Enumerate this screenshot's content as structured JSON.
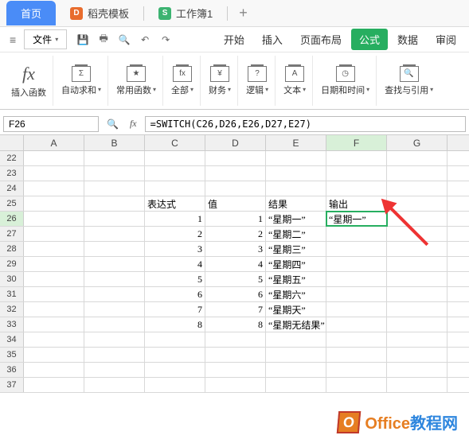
{
  "tabs": {
    "home": "首页",
    "template": "稻壳模板",
    "workbook": "工作簿1",
    "plus": "+"
  },
  "menubar": {
    "file": "文件",
    "start": "开始",
    "insert": "插入",
    "layout": "页面布局",
    "formula": "公式",
    "data": "数据",
    "review": "审阅"
  },
  "ribbon": {
    "insert_fn": "插入函数",
    "insert_fn_icon": "fx",
    "autosum": "自动求和",
    "common": "常用函数",
    "all": "全部",
    "finance": "财务",
    "logic": "逻辑",
    "text": "文本",
    "datetime": "日期和时间",
    "lookup": "查找与引用"
  },
  "formula_bar": {
    "cell_ref": "F26",
    "fx": "fx",
    "formula": "=SWITCH(C26,D26,E26,D27,E27)"
  },
  "columns": [
    "A",
    "B",
    "C",
    "D",
    "E",
    "F",
    "G"
  ],
  "row_start": 22,
  "row_end": 37,
  "headers": {
    "c": "表达式",
    "d": "值",
    "e": "结果",
    "f": "输出"
  },
  "data_rows": [
    {
      "c": "1",
      "d": "1",
      "e": "“星期一”",
      "f": "“星期一”"
    },
    {
      "c": "2",
      "d": "2",
      "e": "“星期二”"
    },
    {
      "c": "3",
      "d": "3",
      "e": "“星期三”"
    },
    {
      "c": "4",
      "d": "4",
      "e": "“星期四”"
    },
    {
      "c": "5",
      "d": "5",
      "e": "“星期五”"
    },
    {
      "c": "6",
      "d": "6",
      "e": "“星期六”"
    },
    {
      "c": "7",
      "d": "7",
      "e": "“星期天”"
    },
    {
      "c": "8",
      "d": "8",
      "e": "“星期无结果”"
    }
  ],
  "active_cell": {
    "col": "F",
    "row": 26
  },
  "watermark": {
    "icon": "O",
    "t1": "Office",
    "t2": "教程网"
  }
}
